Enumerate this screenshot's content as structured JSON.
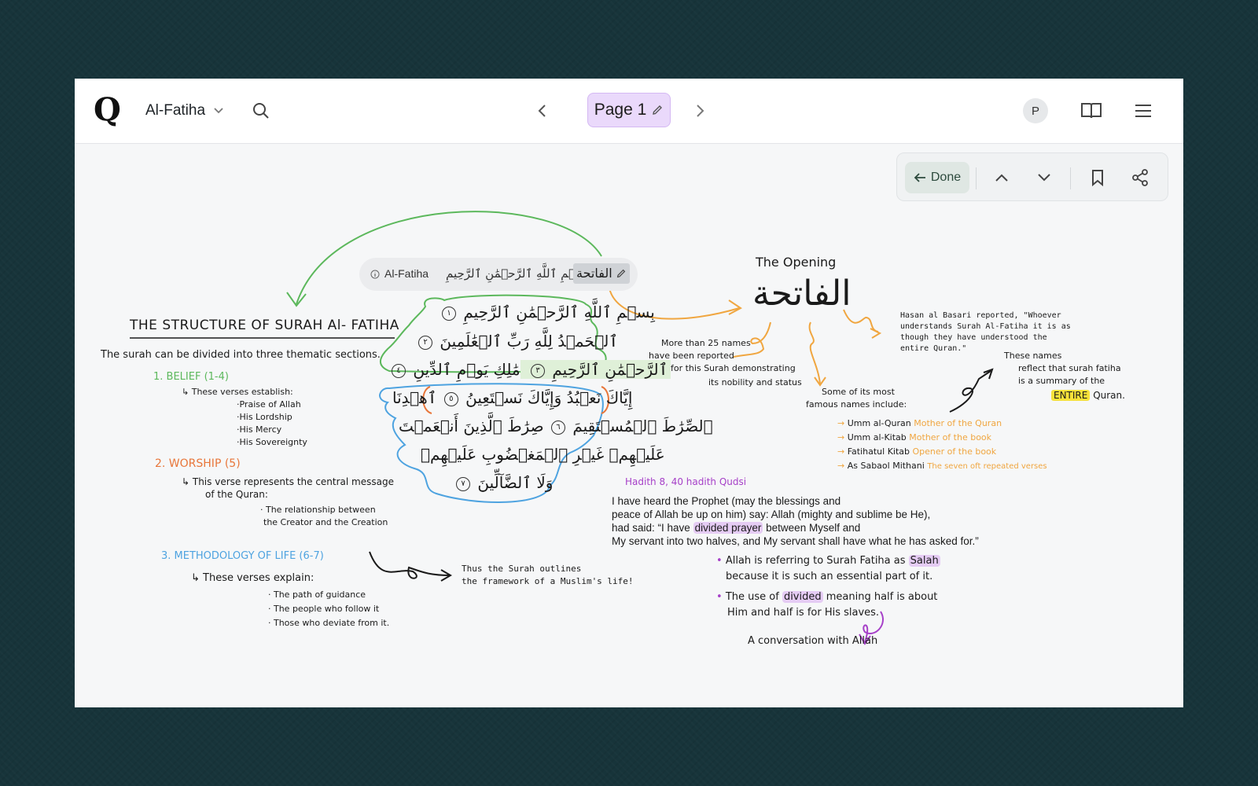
{
  "header": {
    "logo_glyph": "Q",
    "surah_name": "Al-Fatiha",
    "page_label": "Page 1",
    "avatar_letter": "P"
  },
  "toolbar": {
    "done_label": "Done"
  },
  "ref_pill": {
    "name": "Al-Fatiha",
    "basmala": "بِسۡمِ ٱللَّهِ ٱلرَّحۡمَٰنِ ٱلرَّحِيمِ",
    "arabic_title": "الفاتحة"
  },
  "verses": {
    "v1": "بِسۡمِ ٱللَّهِ ٱلرَّحۡمَٰنِ ٱلرَّحِيمِ",
    "v1_num": "١",
    "v2": "ٱلۡحَمۡدُ لِلَّهِ رَبِّ ٱلۡعَٰلَمِينَ",
    "v2_num": "٢",
    "v3a": "ٱلرَّحۡمَٰنِ ٱلرَّحِيمِ",
    "v3_num": "٣",
    "v3b": "مَٰلِكِ يَوۡمِ ٱلدِّينِ",
    "v4_num": "٤",
    "v5": "إِيَّاكَ نَعۡبُدُ وَإِيَّاكَ نَسۡتَعِينُ",
    "v5_num": "٥",
    "v6a": "ٱهۡدِنَا",
    "v6b": "ٱلصِّرَٰطَ ٱلۡمُسۡتَقِيمَ",
    "v6_num": "٦",
    "v7a": "صِرَٰطَ ٱلَّذِينَ أَنۡعَمۡتَ",
    "v7b": "عَلَيۡهِمۡ غَيۡرِ ٱلۡمَغۡضُوبِ عَلَيۡهِمۡ",
    "v7c": "وَلَا ٱلضَّآلِّينَ",
    "v7_num": "٧"
  },
  "structure": {
    "title": "THE STRUCTURE OF SURAH Al- FATIHA",
    "intro": "The surah can be divided into three thematic sections.",
    "s1_title": "1. BELIEF (1-4)",
    "s1_desc": "These verses establish:",
    "s1_items": [
      "·Praise of Allah",
      "·His Lordship",
      "·His Mercy",
      "·His Sovereignty"
    ],
    "s2_title": "2. WORSHIP (5)",
    "s2_desc_1": "This verse represents the central message",
    "s2_desc_2": "of the Quran:",
    "s2_item_1": "· The relationship between",
    "s2_item_2": "the Creator and the Creation",
    "s3_title": "3. METHODOLOGY OF LIFE (6-7)",
    "s3_desc": "These verses explain:",
    "s3_items": [
      "· The path of guidance",
      "· The people who follow it",
      "· Those who deviate from it."
    ],
    "outline_note_1": "Thus the Surah outlines",
    "outline_note_2": "the framework of a Muslim's life!"
  },
  "opening": {
    "label": "The Opening",
    "arabic": "الفاتحة",
    "names_note_1": "More than 25 names",
    "names_note_2": "have been reported",
    "names_note_3": "for this Surah demonstrating",
    "names_note_4": "its nobility and status",
    "hasan_quote_1": "Hasan al Basari reported, \"Whoever",
    "hasan_quote_2": "understands Surah Al-Fatiha it is as",
    "hasan_quote_3": "though they have understood the",
    "hasan_quote_4": "entire Quran.\"",
    "famous_1": "Some of its most",
    "famous_2": "famous names include:",
    "names": [
      {
        "name": "Umm al-Quran",
        "meaning": "Mother of the Quran"
      },
      {
        "name": "Umm al-Kitab",
        "meaning": "Mother of the book"
      },
      {
        "name": "Fatihatul Kitab",
        "meaning": "Opener of the book"
      },
      {
        "name": "As Sabaol Mithani",
        "meaning": "The seven oft repeated verses"
      }
    ],
    "summary_1": "These names",
    "summary_2": "reflect that surah fatiha",
    "summary_3": "is a summary of the",
    "summary_entire": "ENTIRE",
    "summary_4": "Quran."
  },
  "hadith": {
    "label": "Hadith 8, 40 hadith Qudsi",
    "line1": "I have heard the Prophet (may the blessings and",
    "line2": "peace of Allah be up on him) say: Allah (mighty and sublime be He),",
    "line3_a": "had said: “I have",
    "line3_hl": "divided prayer",
    "line3_b": "between Myself and",
    "line4": "My servant into two halves, and My servant shall have what he has asked for.”",
    "b1_a": "Allah is referring to Surah Fatiha as",
    "b1_hl": "Salah",
    "b1_b": "because it is such an essential part of it.",
    "b2_a": "The use of",
    "b2_hl": "divided",
    "b2_b": "meaning half is about",
    "b2_c": "Him and half is for His slaves.",
    "conversation": "A conversation with Allah"
  },
  "colors": {
    "green": "#5cb85c",
    "orange": "#f0a640",
    "blue": "#4ea3e0",
    "purple": "#a640c8",
    "dark_orange": "#e8763a"
  }
}
